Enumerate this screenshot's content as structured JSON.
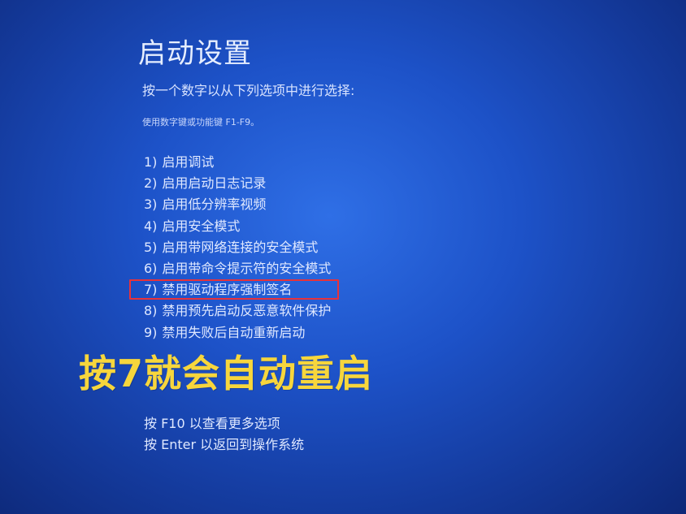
{
  "screen": {
    "title": "启动设置",
    "subtitle": "按一个数字以从下列选项中进行选择:",
    "hint": "使用数字键或功能键 F1-F9。",
    "options": [
      {
        "num": "1)",
        "label": "启用调试"
      },
      {
        "num": "2)",
        "label": "启用启动日志记录"
      },
      {
        "num": "3)",
        "label": "启用低分辨率视频"
      },
      {
        "num": "4)",
        "label": "启用安全模式"
      },
      {
        "num": "5)",
        "label": "启用带网络连接的安全模式"
      },
      {
        "num": "6)",
        "label": "启用带命令提示符的安全模式"
      },
      {
        "num": "7)",
        "label": "禁用驱动程序强制签名"
      },
      {
        "num": "8)",
        "label": "禁用预先启动反恶意软件保护"
      },
      {
        "num": "9)",
        "label": "禁用失败后自动重新启动"
      }
    ],
    "highlighted_option": "7)",
    "annotation": "按7就会自动重启",
    "footer": {
      "more_options": "按 F10 以查看更多选项",
      "return": "按 Enter 以返回到操作系统"
    }
  },
  "colors": {
    "background": "#1d52c8",
    "text": "#dfe8ff",
    "highlight_border": "#e8323a",
    "annotation": "#f7d63c"
  }
}
